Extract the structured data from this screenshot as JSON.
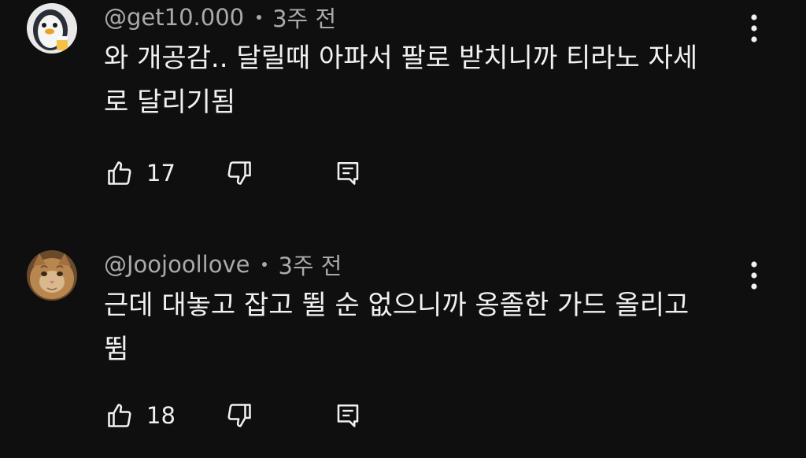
{
  "comments": [
    {
      "author": "@get10.000",
      "time": "3주 전",
      "text_line1": "와 개공감.. 달릴때 아파서 팔로 받치니까 티라노 자세",
      "text_line2": "로 달리기됨",
      "likes": "17",
      "avatar_icon": "penguin-avatar-icon"
    },
    {
      "author": "@Joojoollove",
      "time": "3주 전",
      "text_line1": "근데 대놓고 잡고 뛸 순 없으니까 옹졸한 가드 올리고",
      "text_line2": "뜀",
      "likes": "18",
      "avatar_icon": "cat-avatar-icon"
    }
  ],
  "icons": {
    "like": "thumbs-up-icon",
    "dislike": "thumbs-down-icon",
    "reply": "reply-comment-icon",
    "more": "more-vertical-icon"
  },
  "colors": {
    "background": "#0f0f0f",
    "primary_text": "#f1f1f1",
    "secondary_text": "#aaaaaa"
  }
}
